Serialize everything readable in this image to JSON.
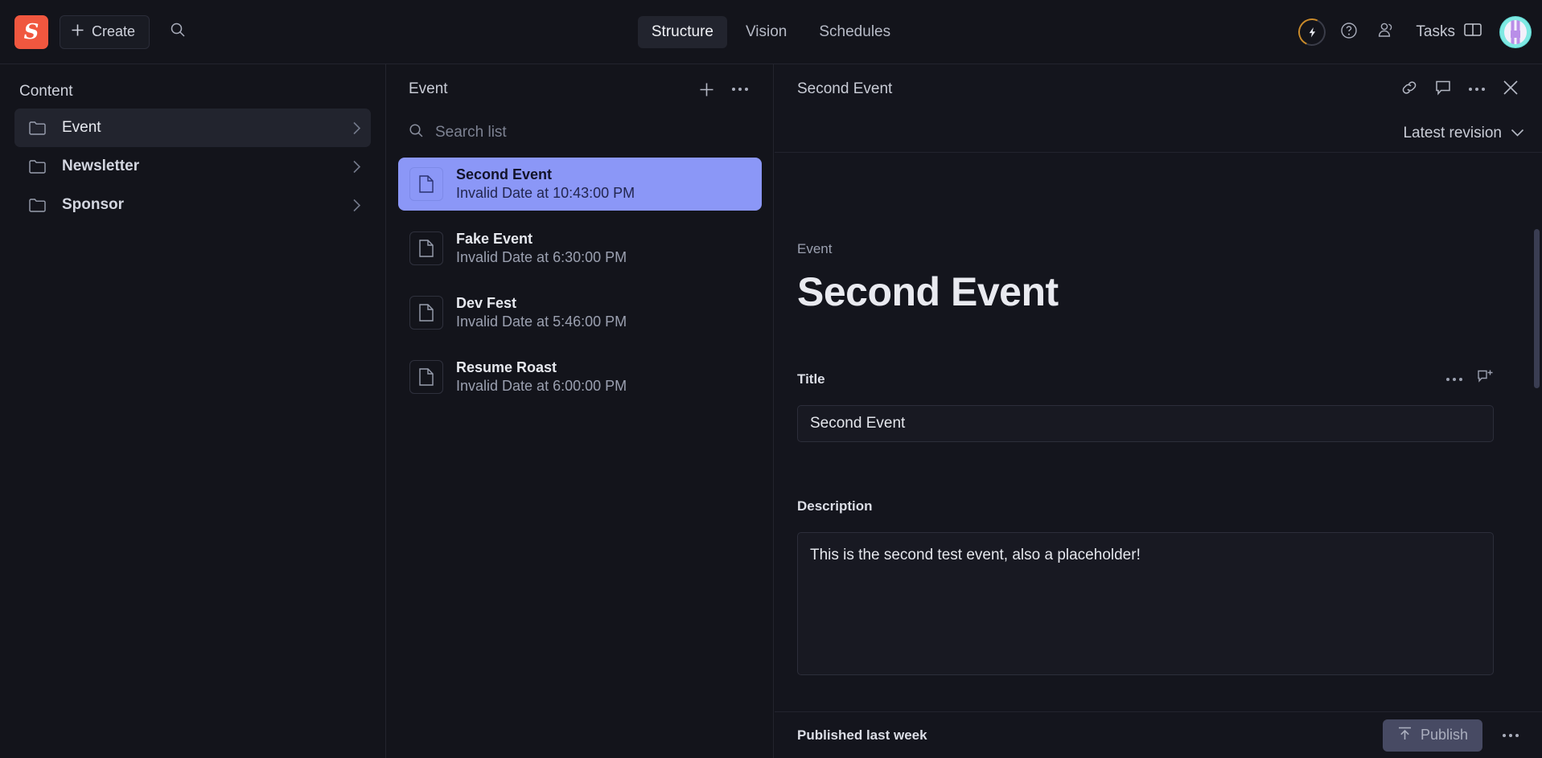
{
  "topbar": {
    "logo_letter": "S",
    "create_label": "Create",
    "nav": [
      {
        "label": "Structure",
        "active": true
      },
      {
        "label": "Vision",
        "active": false
      },
      {
        "label": "Schedules",
        "active": false
      }
    ],
    "tasks_label": "Tasks"
  },
  "sidebar": {
    "title": "Content",
    "items": [
      {
        "label": "Event",
        "active": true
      },
      {
        "label": "Newsletter",
        "active": false
      },
      {
        "label": "Sponsor",
        "active": false
      }
    ]
  },
  "list_panel": {
    "title": "Event",
    "search_placeholder": "Search list",
    "items": [
      {
        "name": "Second Event",
        "date": "Invalid Date at 10:43:00 PM",
        "selected": true
      },
      {
        "name": "Fake Event",
        "date": "Invalid Date at 6:30:00 PM",
        "selected": false
      },
      {
        "name": "Dev Fest",
        "date": "Invalid Date at 5:46:00 PM",
        "selected": false
      },
      {
        "name": "Resume Roast",
        "date": "Invalid Date at 6:00:00 PM",
        "selected": false
      }
    ]
  },
  "document": {
    "header_title": "Second Event",
    "revision_label": "Latest revision",
    "kicker": "Event",
    "heading": "Second Event",
    "fields": [
      {
        "label": "Title",
        "value": "Second Event"
      },
      {
        "label": "Description",
        "value": "This is the second test event, also a placeholder!"
      }
    ],
    "footer_status": "Published last week",
    "publish_label": "Publish"
  },
  "colors": {
    "brand": "#f0573f",
    "selection": "#8b97f7",
    "publish": "#474a63",
    "background": "#13141b"
  }
}
